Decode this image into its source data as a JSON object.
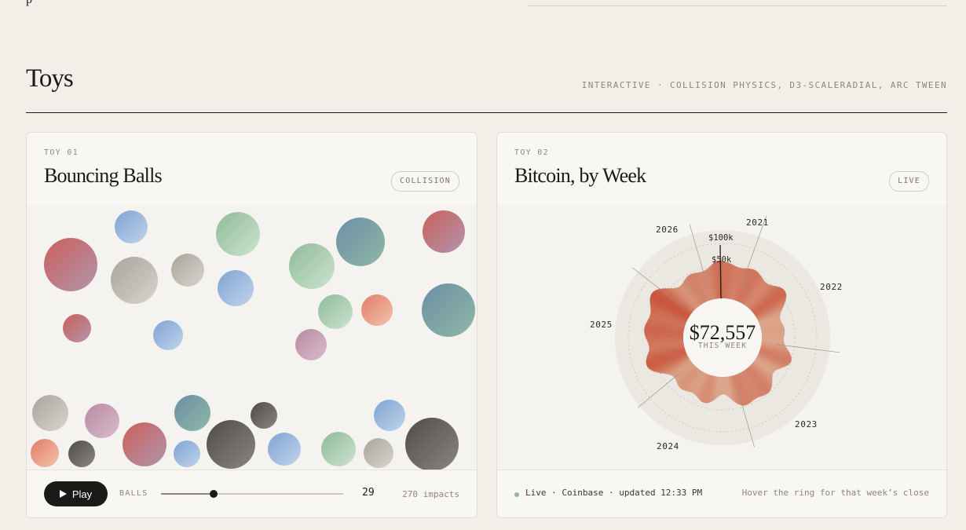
{
  "header": {
    "fragment": "p",
    "title": "Toys",
    "meta": "INTERACTIVE · COLLISION PHYSICS, D3-SCALERADIAL, ARC TWEEN"
  },
  "toy1": {
    "eyebrow": "TOY 01",
    "title": "Bouncing Balls",
    "badge": "COLLISION",
    "controls": {
      "play_label": "Play",
      "balls_label": "BALLS",
      "ball_count": "29",
      "ball_fraction": 0.29,
      "impacts": "270 impacts"
    }
  },
  "toy2": {
    "eyebrow": "TOY 02",
    "title": "Bitcoin, by Week",
    "badge": "LIVE",
    "center_value": "$72,557",
    "center_label": "THIS WEEK",
    "scale_labels": [
      "$100k",
      "$50k"
    ],
    "year_labels": [
      "2021",
      "2022",
      "2023",
      "2024",
      "2025",
      "2026"
    ],
    "status": "Live · Coinbase · updated 12:33 PM",
    "hint": "Hover the ring for that week’s close"
  },
  "colors": {
    "ball_palette": [
      "#e27d67",
      "#7ea3d2",
      "#a8a39b",
      "#8fba99",
      "#6b8fa6",
      "#b88aa0",
      "#4f4c47",
      "#c9605a"
    ],
    "btc_high": "#c23b22",
    "btc_low": "#dba48a"
  }
}
